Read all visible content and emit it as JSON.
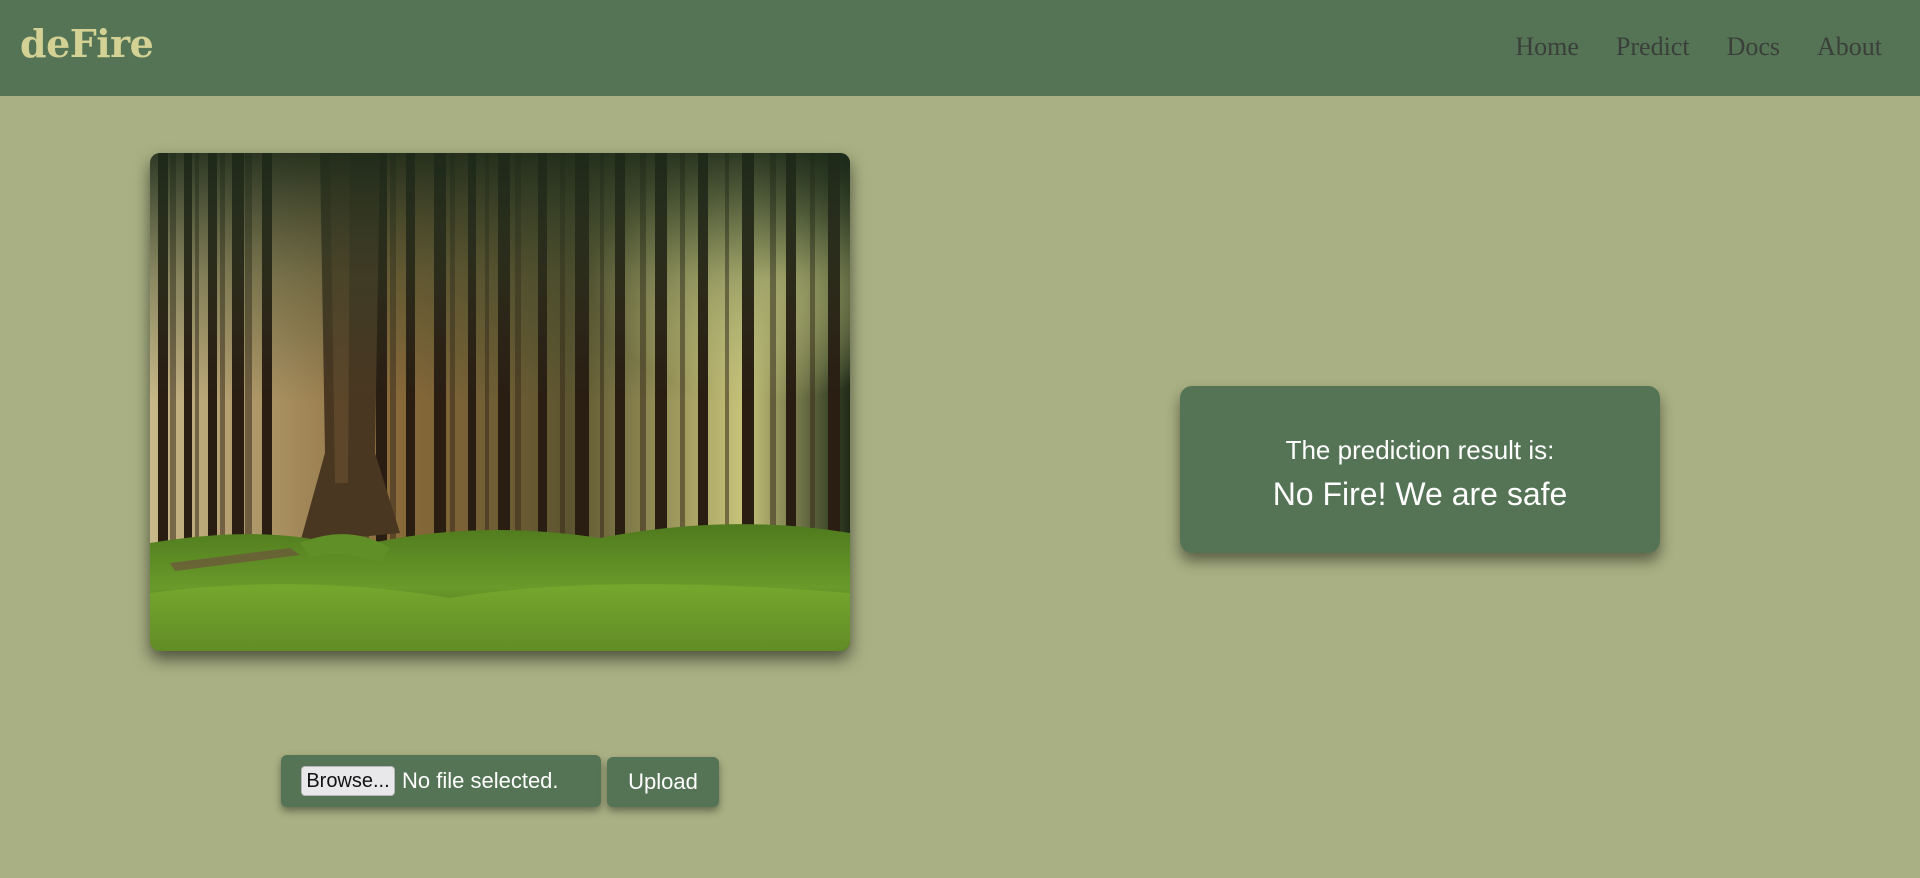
{
  "navbar": {
    "brand": "deFire",
    "links": [
      {
        "label": "Home"
      },
      {
        "label": "Predict"
      },
      {
        "label": "Docs"
      },
      {
        "label": "About"
      }
    ]
  },
  "photo": {
    "subject": "pine forest with mossy floor"
  },
  "result": {
    "label": "The prediction result is:",
    "value": "No Fire! We are safe"
  },
  "upload_form": {
    "browse_label": "Browse...",
    "file_status": "No file selected.",
    "upload_label": "Upload"
  },
  "colors": {
    "background": "#a9b083",
    "navbar": "#557455",
    "brand": "#d3d194",
    "nav_link": "#3b3f3a",
    "card": "#557455",
    "card_text": "#ffffff"
  }
}
